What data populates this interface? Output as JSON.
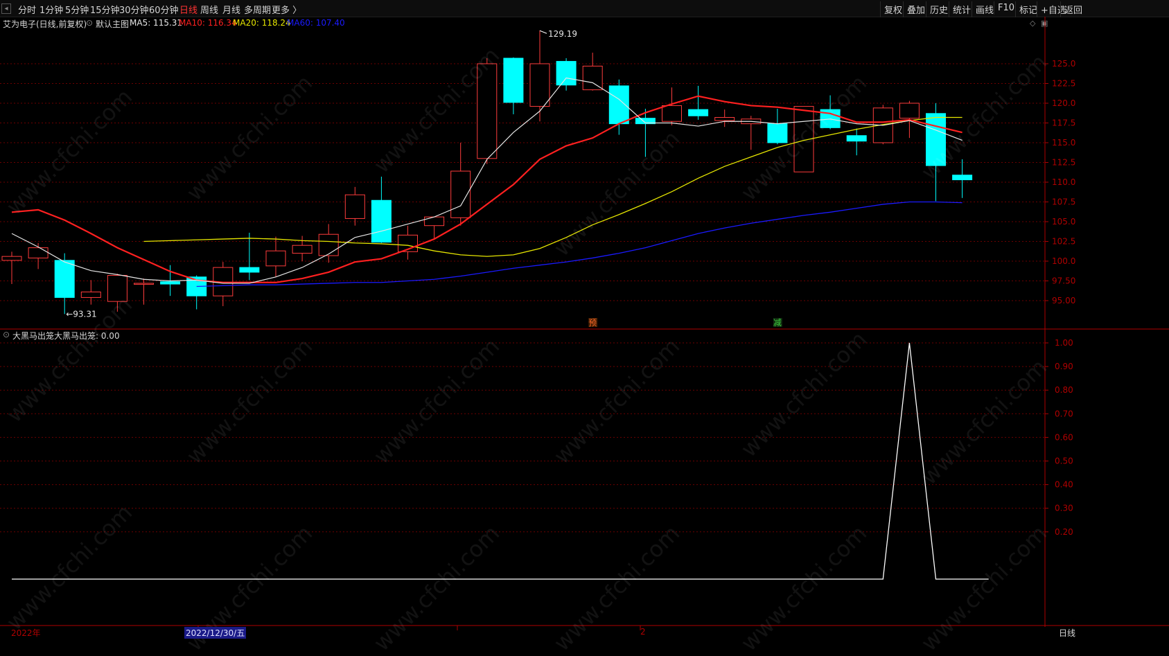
{
  "toolbar": {
    "periods": [
      "分时",
      "1分钟",
      "5分钟",
      "15分钟",
      "30分钟",
      "60分钟",
      "日线",
      "周线",
      "月线",
      "多周期",
      "更多 〉"
    ],
    "active_period": "日线",
    "right_buttons": [
      "复权",
      "叠加",
      "历史",
      "统计",
      "画线",
      "F10",
      "标记",
      "+自选",
      "返回"
    ]
  },
  "main_panel": {
    "stock_label": "艾为电子(日线,前复权)",
    "template_label": "默认主图",
    "ma5": "MA5: 115.31",
    "ma10": "MA10: 116.34",
    "ma20": "MA20: 118.24",
    "ma60": "MA60: 107.40",
    "high_label": "129.19",
    "low_label": "93.31",
    "marker_yu": "预",
    "marker_jian": "减",
    "y_ticks": [
      "125.0",
      "122.5",
      "120.0",
      "117.5",
      "115.0",
      "112.5",
      "110.0",
      "107.5",
      "105.0",
      "102.5",
      "100.0",
      "97.50",
      "95.00"
    ]
  },
  "sub_panel": {
    "title": "大黑马出笼",
    "value_label": "大黑马出笼: 0.00",
    "y_ticks": [
      "1.00",
      "0.90",
      "0.80",
      "0.70",
      "0.60",
      "0.50",
      "0.40",
      "0.30",
      "0.20"
    ]
  },
  "bottom_bar": {
    "year_label": "2022年",
    "date_label": "2022/12/30/五",
    "month_label": "2",
    "period_label": "日线"
  },
  "watermark": "www.cfchi.com",
  "colors": {
    "up": "#ff3c3c",
    "down": "#00ffff",
    "ma5": "#e6e6e6",
    "ma10": "#ff2020",
    "ma20": "#e6e600",
    "ma60": "#1a1aff",
    "axis": "#b00000",
    "grid": "#6e0000"
  },
  "chart_data": {
    "type": "candlestick",
    "candles": [
      {
        "o": 100.1,
        "h": 101.2,
        "l": 97.1,
        "c": 100.6
      },
      {
        "o": 100.4,
        "h": 102.3,
        "l": 99.0,
        "c": 101.7
      },
      {
        "o": 100.1,
        "h": 101.0,
        "l": 93.3,
        "c": 95.4
      },
      {
        "o": 95.4,
        "h": 97.6,
        "l": 94.5,
        "c": 96.1
      },
      {
        "o": 94.9,
        "h": 98.4,
        "l": 93.6,
        "c": 98.2
      },
      {
        "o": 97.2,
        "h": 97.8,
        "l": 94.5,
        "c": 97.2
      },
      {
        "o": 97.4,
        "h": 99.5,
        "l": 95.6,
        "c": 97.1
      },
      {
        "o": 98.0,
        "h": 98.2,
        "l": 93.9,
        "c": 95.6
      },
      {
        "o": 95.6,
        "h": 99.9,
        "l": 94.3,
        "c": 99.2
      },
      {
        "o": 99.2,
        "h": 103.6,
        "l": 97.6,
        "c": 98.6
      },
      {
        "o": 99.4,
        "h": 103.1,
        "l": 98.0,
        "c": 101.3
      },
      {
        "o": 101.0,
        "h": 103.2,
        "l": 100.0,
        "c": 102.0
      },
      {
        "o": 100.7,
        "h": 104.7,
        "l": 99.8,
        "c": 103.4
      },
      {
        "o": 105.4,
        "h": 109.4,
        "l": 104.5,
        "c": 108.4
      },
      {
        "o": 107.7,
        "h": 110.7,
        "l": 102.3,
        "c": 102.4
      },
      {
        "o": 101.2,
        "h": 104.5,
        "l": 100.2,
        "c": 103.3
      },
      {
        "o": 104.5,
        "h": 105.6,
        "l": 102.8,
        "c": 105.6
      },
      {
        "o": 105.5,
        "h": 115.0,
        "l": 104.5,
        "c": 111.4
      },
      {
        "o": 113.0,
        "h": 125.7,
        "l": 112.3,
        "c": 125.0
      },
      {
        "o": 125.7,
        "h": 125.8,
        "l": 118.6,
        "c": 120.1
      },
      {
        "o": 119.6,
        "h": 129.2,
        "l": 117.7,
        "c": 125.0
      },
      {
        "o": 125.3,
        "h": 125.7,
        "l": 121.6,
        "c": 122.3
      },
      {
        "o": 121.7,
        "h": 126.4,
        "l": 121.6,
        "c": 124.7
      },
      {
        "o": 122.2,
        "h": 123.0,
        "l": 116.0,
        "c": 117.4
      },
      {
        "o": 118.1,
        "h": 119.3,
        "l": 113.2,
        "c": 117.4
      },
      {
        "o": 117.7,
        "h": 122.0,
        "l": 117.2,
        "c": 119.7
      },
      {
        "o": 119.2,
        "h": 122.2,
        "l": 117.9,
        "c": 118.4
      },
      {
        "o": 117.8,
        "h": 119.2,
        "l": 117.0,
        "c": 118.2
      },
      {
        "o": 117.4,
        "h": 118.4,
        "l": 114.1,
        "c": 118.0
      },
      {
        "o": 117.4,
        "h": 119.3,
        "l": 114.8,
        "c": 115.0
      },
      {
        "o": 111.3,
        "h": 119.6,
        "l": 111.3,
        "c": 119.6
      },
      {
        "o": 119.2,
        "h": 121.0,
        "l": 116.7,
        "c": 116.9
      },
      {
        "o": 115.9,
        "h": 116.8,
        "l": 113.4,
        "c": 115.2
      },
      {
        "o": 115.0,
        "h": 119.8,
        "l": 114.8,
        "c": 119.4
      },
      {
        "o": 118.1,
        "h": 120.3,
        "l": 115.6,
        "c": 120.0
      },
      {
        "o": 118.7,
        "h": 120.0,
        "l": 107.6,
        "c": 112.1
      },
      {
        "o": 110.9,
        "h": 112.9,
        "l": 108.0,
        "c": 110.3
      }
    ],
    "ma5": [
      103.5,
      101.8,
      99.9,
      98.8,
      98.3,
      97.7,
      97.5,
      97.6,
      97.2,
      97.2,
      98.0,
      99.2,
      100.9,
      103.0,
      103.8,
      104.7,
      105.6,
      107.0,
      112.9,
      116.3,
      119.0,
      123.2,
      122.6,
      120.5,
      117.5,
      117.5,
      117.1,
      117.7,
      117.7,
      117.4,
      117.7,
      118.0,
      117.4,
      117.2,
      117.8,
      116.6,
      115.3
    ],
    "ma10": [
      106.2,
      106.5,
      105.2,
      103.5,
      101.7,
      100.2,
      98.7,
      97.6,
      97.3,
      97.3,
      97.3,
      97.8,
      98.6,
      99.9,
      100.3,
      101.5,
      102.8,
      104.7,
      107.2,
      109.7,
      112.9,
      114.6,
      115.6,
      117.4,
      118.8,
      119.9,
      120.9,
      120.2,
      119.7,
      119.5,
      119.1,
      118.7,
      117.6,
      117.6,
      117.9,
      117.1,
      116.3
    ],
    "ma20": [
      102.5,
      102.6,
      102.7,
      102.8,
      102.9,
      102.8,
      102.6,
      102.5,
      102.3,
      102.2,
      102.0,
      101.3,
      100.8,
      100.6,
      100.8,
      101.6,
      103.0,
      104.6,
      105.9,
      107.3,
      108.8,
      110.5,
      112.0,
      113.2,
      114.4,
      115.3,
      116.0,
      116.7,
      117.3,
      117.8,
      118.2,
      118.2
    ],
    "ma60": [
      96.8,
      96.9,
      97.0,
      97.0,
      97.1,
      97.2,
      97.3,
      97.3,
      97.5,
      97.7,
      98.1,
      98.6,
      99.1,
      99.5,
      99.9,
      100.4,
      101.0,
      101.7,
      102.6,
      103.5,
      104.2,
      104.8,
      105.3,
      105.8,
      106.2,
      106.7,
      107.2,
      107.5,
      107.5,
      107.4
    ],
    "signal": [
      0,
      0,
      0,
      0,
      0,
      0,
      0,
      0,
      0,
      0,
      0,
      0,
      0,
      0,
      0,
      0,
      0,
      0,
      0,
      0,
      0,
      0,
      0,
      0,
      0,
      0,
      0,
      0,
      0,
      0,
      0,
      0,
      0,
      0,
      1,
      0,
      0,
      0
    ]
  }
}
